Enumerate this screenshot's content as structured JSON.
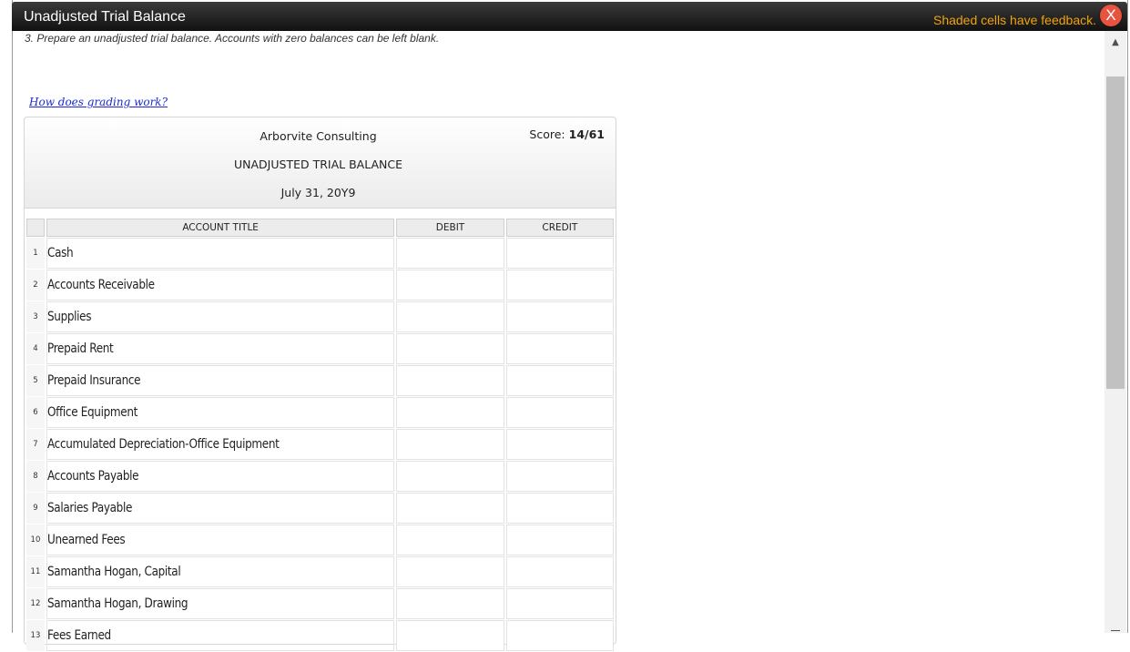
{
  "window": {
    "title": "Unadjusted Trial Balance",
    "feedback_notice": "Shaded cells have feedback.",
    "close_label": "X"
  },
  "instructions": "3. Prepare an unadjusted trial balance. Accounts with zero balances can be left blank.",
  "grading_link": "How does grading work?",
  "header": {
    "company": "Arborvite Consulting",
    "statement": "UNADJUSTED TRIAL BALANCE",
    "date": "July 31, 20Y9",
    "score_label": "Score:",
    "score_value": "14/61"
  },
  "columns": {
    "account": "ACCOUNT TITLE",
    "debit": "DEBIT",
    "credit": "CREDIT"
  },
  "rows": [
    {
      "num": "1",
      "account": "Cash",
      "debit": "",
      "credit": ""
    },
    {
      "num": "2",
      "account": "Accounts Receivable",
      "debit": "",
      "credit": ""
    },
    {
      "num": "3",
      "account": "Supplies",
      "debit": "",
      "credit": ""
    },
    {
      "num": "4",
      "account": "Prepaid Rent",
      "debit": "",
      "credit": ""
    },
    {
      "num": "5",
      "account": "Prepaid Insurance",
      "debit": "",
      "credit": ""
    },
    {
      "num": "6",
      "account": "Office Equipment",
      "debit": "",
      "credit": ""
    },
    {
      "num": "7",
      "account": "Accumulated Depreciation-Office Equipment",
      "debit": "",
      "credit": ""
    },
    {
      "num": "8",
      "account": "Accounts Payable",
      "debit": "",
      "credit": ""
    },
    {
      "num": "9",
      "account": "Salaries Payable",
      "debit": "",
      "credit": ""
    },
    {
      "num": "10",
      "account": "Unearned Fees",
      "debit": "",
      "credit": ""
    },
    {
      "num": "11",
      "account": "Samantha Hogan, Capital",
      "debit": "",
      "credit": ""
    },
    {
      "num": "12",
      "account": "Samantha Hogan, Drawing",
      "debit": "",
      "credit": ""
    },
    {
      "num": "13",
      "account": "Fees Earned",
      "debit": "",
      "credit": ""
    }
  ],
  "colors": {
    "feedback": "#f0a30a",
    "close_button": "#e8533f",
    "link": "#1a2bd6"
  }
}
